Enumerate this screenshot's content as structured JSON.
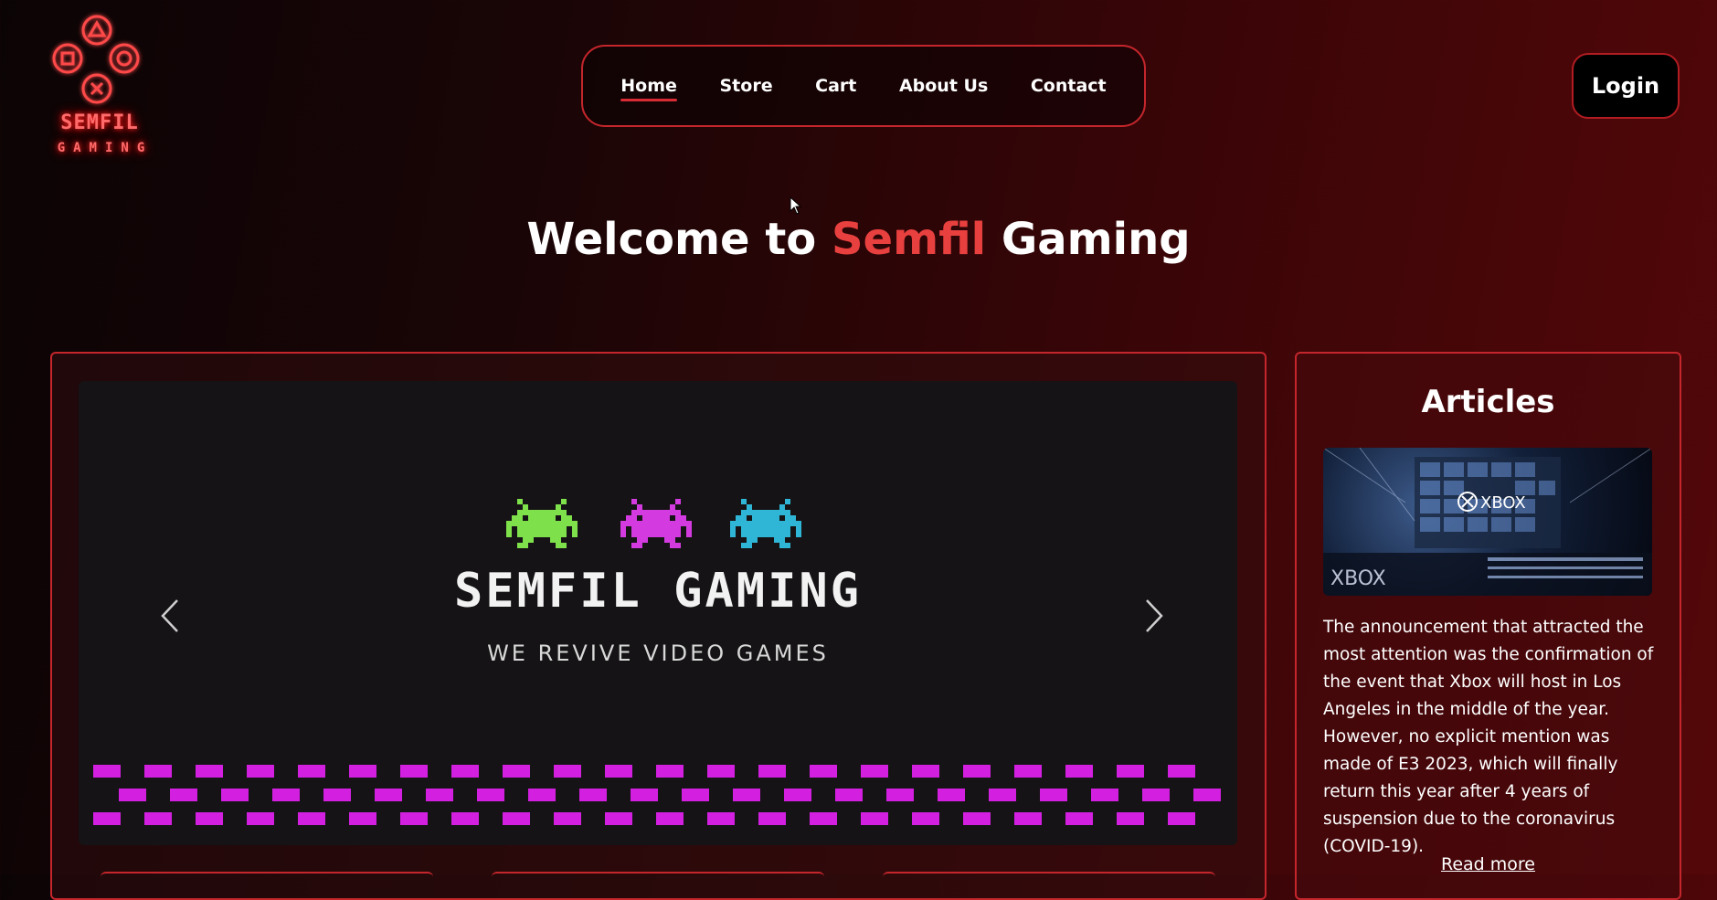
{
  "brand": {
    "name_line1": "SEMFIL",
    "name_line2": "GAMING",
    "logo_icon": "gamepad-buttons-icon",
    "accent_color": "#e8403f"
  },
  "nav": {
    "items": [
      {
        "label": "Home",
        "active": true
      },
      {
        "label": "Store",
        "active": false
      },
      {
        "label": "Cart",
        "active": false
      },
      {
        "label": "About Us",
        "active": false
      },
      {
        "label": "Contact",
        "active": false
      }
    ]
  },
  "login": {
    "label": "Login"
  },
  "welcome": {
    "prefix": "Welcome to",
    "highlight": "Semfil",
    "suffix": "Gaming"
  },
  "carousel": {
    "title": "SEMFIL GAMING",
    "subtitle": "WE REVIVE VIDEO GAMES",
    "invader_colors": [
      "#7ee04a",
      "#d33be0",
      "#2fb6d6"
    ],
    "checker_color": "#d21fe0",
    "prev_icon": "chevron-left-icon",
    "next_icon": "chevron-right-icon"
  },
  "articles": {
    "title": "Articles",
    "image_brand": "XBOX",
    "text": "The announcement that attracted the most attention was the confirmation of the event that Xbox will host in Los Angeles in the middle of the year. However, no explicit mention was made of E3 2023, which will finally return this year after 4 years of suspension due to the coronavirus (COVID-19).",
    "read_more": "Read more"
  }
}
